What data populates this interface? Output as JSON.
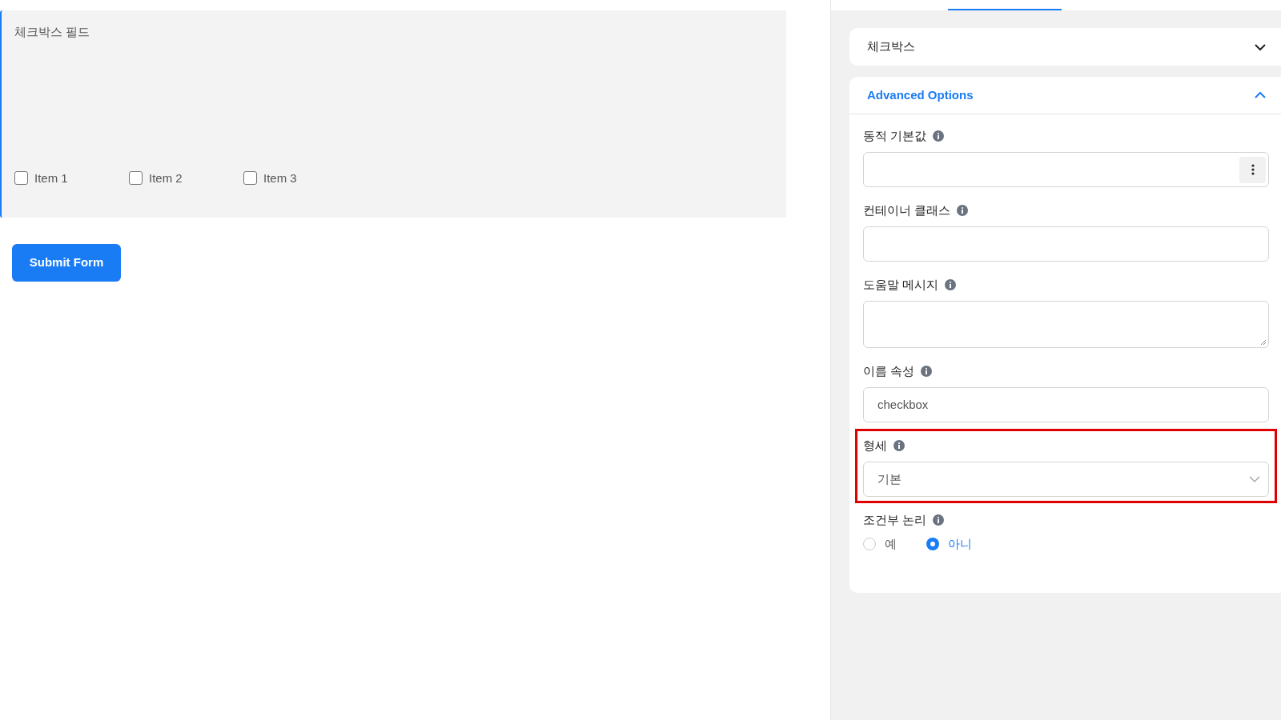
{
  "field_preview": {
    "label": "체크박스 필드",
    "options": [
      {
        "label": "Item 1",
        "checked": false
      },
      {
        "label": "Item 2",
        "checked": false
      },
      {
        "label": "Item 3",
        "checked": false
      }
    ]
  },
  "submit_button": "Submit Form",
  "settings_panel": {
    "tabs": [
      {
        "selected": true
      }
    ],
    "sections": [
      {
        "title": "체크박스",
        "expanded": false
      },
      {
        "title": "Advanced Options",
        "expanded": true,
        "fields": [
          {
            "kind": "menu-input",
            "label": "동적 기본값",
            "highlighted": false
          },
          {
            "kind": "input",
            "label": "컨테이너 클래스",
            "highlighted": false
          },
          {
            "kind": "textarea",
            "label": "도움말 메시지",
            "highlighted": false
          },
          {
            "kind": "input",
            "label": "이름 속성",
            "value": "checkbox",
            "highlighted": false
          },
          {
            "kind": "select",
            "label": "형세",
            "value": "기본",
            "highlighted": true
          },
          {
            "kind": "radio",
            "label": "조건부 논리",
            "highlighted": false,
            "options": [
              {
                "label": "예",
                "selected": false
              },
              {
                "label": "아니",
                "selected": true
              }
            ]
          }
        ]
      }
    ]
  }
}
